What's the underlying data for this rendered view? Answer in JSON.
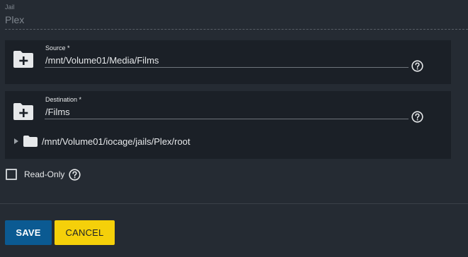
{
  "jail": {
    "label": "Jail",
    "value": "Plex"
  },
  "source": {
    "label": "Source *",
    "value": "/mnt/Volume01/Media/Films",
    "icon": "folder-add-icon"
  },
  "destination": {
    "label": "Destination *",
    "value": "/Films",
    "icon": "folder-add-icon",
    "tree": {
      "expanded": false,
      "path": "/mnt/Volume01/iocage/jails/Plex/root"
    }
  },
  "read_only": {
    "label": "Read-Only",
    "checked": false
  },
  "buttons": {
    "save": "SAVE",
    "cancel": "CANCEL"
  },
  "colors": {
    "background": "#252b33",
    "panel": "#1b2027",
    "save": "#0b5a92",
    "cancel": "#f5d00a"
  }
}
